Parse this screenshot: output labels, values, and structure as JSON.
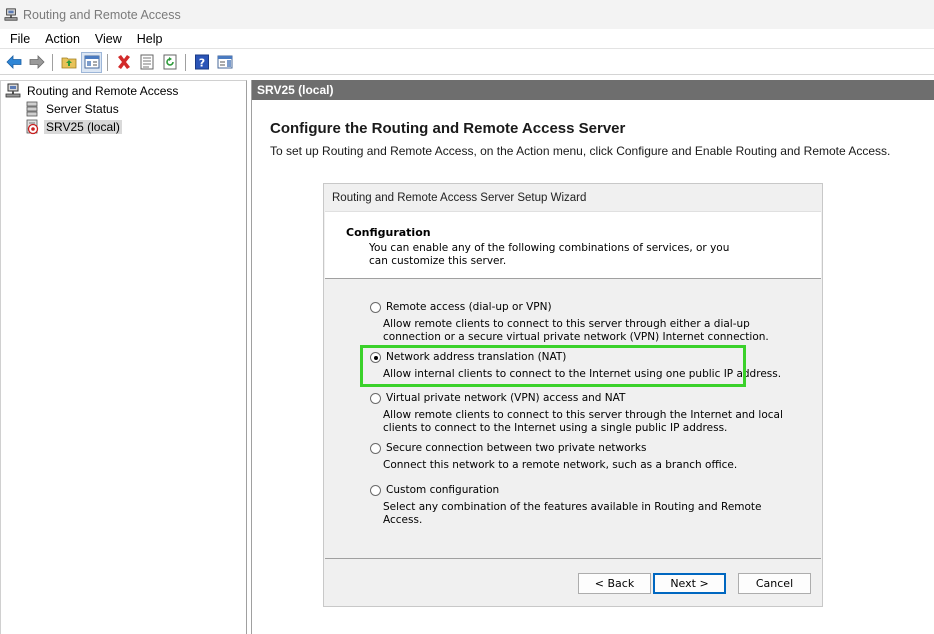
{
  "window": {
    "title": "Routing and Remote Access"
  },
  "menu": {
    "items": [
      "File",
      "Action",
      "View",
      "Help"
    ]
  },
  "toolbar": {
    "icons": [
      "back-arrow-icon",
      "forward-arrow-icon",
      "up-folder-icon",
      "show-tree-icon",
      "delete-icon",
      "properties-icon",
      "refresh-icon",
      "help-icon",
      "action-pane-icon"
    ]
  },
  "tree": {
    "root": "Routing and Remote Access",
    "children": [
      "Server Status",
      "SRV25 (local)"
    ],
    "selected": "SRV25 (local)"
  },
  "content": {
    "header": "SRV25 (local)",
    "title": "Configure the Routing and Remote Access Server",
    "description": "To set up Routing and Remote Access, on the Action menu, click Configure and Enable Routing and Remote Access."
  },
  "wizard": {
    "title": "Routing and Remote Access Server Setup Wizard",
    "header_title": "Configuration",
    "header_sub": "You can enable any of the following combinations of services, or you can customize this server.",
    "options": [
      {
        "label": "Remote access (dial-up or VPN)",
        "desc": "Allow remote clients to connect to this server through either a dial-up connection or a secure virtual private network (VPN) Internet connection.",
        "checked": false
      },
      {
        "label": "Network address translation (NAT)",
        "desc": "Allow internal clients to connect to the Internet using one public IP address.",
        "checked": true
      },
      {
        "label": "Virtual private network (VPN) access and NAT",
        "desc": "Allow remote clients to connect to this server through the Internet and local clients to connect to the Internet using a single public IP address.",
        "checked": false
      },
      {
        "label": "Secure connection between two private networks",
        "desc": "Connect this network to a remote network, such as a branch office.",
        "checked": false
      },
      {
        "label": "Custom configuration",
        "desc": "Select any combination of the features available in Routing and Remote Access.",
        "checked": false
      }
    ],
    "buttons": {
      "back": "< Back",
      "next": "Next >",
      "cancel": "Cancel"
    },
    "highlight_color": "#3ad12a"
  }
}
